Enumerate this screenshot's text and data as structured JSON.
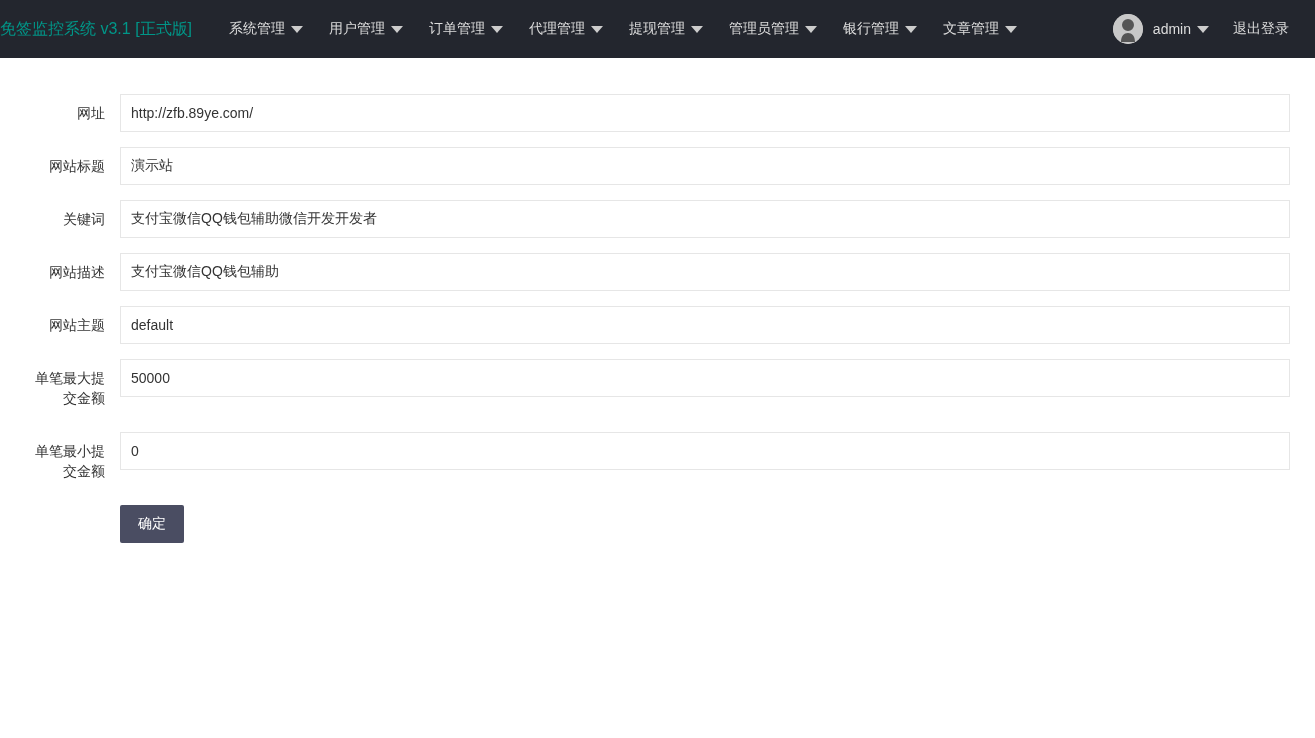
{
  "header": {
    "logo": "免签监控系统 v3.1 [正式版]",
    "menu": [
      {
        "label": "系统管理"
      },
      {
        "label": "用户管理"
      },
      {
        "label": "订单管理"
      },
      {
        "label": "代理管理"
      },
      {
        "label": "提现管理"
      },
      {
        "label": "管理员管理"
      },
      {
        "label": "银行管理"
      },
      {
        "label": "文章管理"
      }
    ],
    "user": "admin",
    "logout": "退出登录"
  },
  "form": {
    "fields": [
      {
        "label": "网址",
        "value": "http://zfb.89ye.com/"
      },
      {
        "label": "网站标题",
        "value": "演示站"
      },
      {
        "label": "关键词",
        "value": "支付宝微信QQ钱包辅助微信开发开发者"
      },
      {
        "label": "网站描述",
        "value": "支付宝微信QQ钱包辅助"
      },
      {
        "label": "网站主题",
        "value": "default"
      },
      {
        "label": "单笔最大提交金额",
        "value": "50000"
      },
      {
        "label": "单笔最小提交金额",
        "value": "0"
      }
    ],
    "submit": "确定"
  }
}
